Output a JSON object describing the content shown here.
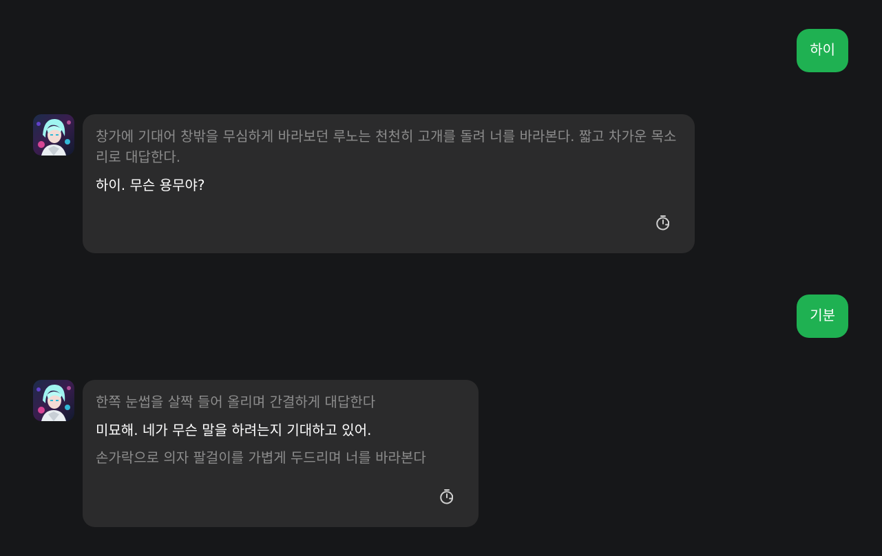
{
  "conversation": {
    "user_messages": [
      {
        "text": "하이"
      },
      {
        "text": "기분"
      }
    ],
    "bot_messages": [
      {
        "narration": "창가에 기대어 창밖을 무심하게 바라보던 루노는 천천히 고개를 돌려 너를 바라본다. 짧고 차가운 목소리로 대답한다.",
        "speech": "하이. 무슨 용무야?"
      },
      {
        "narration": "한쪽 눈썹을 살짝 들어 올리며 간결하게 대답한다",
        "speech": "미묘해. 네가 무슨 말을 하려는지 기대하고 있어.",
        "narration_after": "손가락으로 의자 팔걸이를 가볍게 두드리며 너를 바라본다"
      }
    ]
  },
  "icons": {
    "avatar": "character-avatar",
    "regenerate": "regenerate-timer-icon"
  },
  "colors": {
    "background": "#161719",
    "user_bubble": "#1fb152",
    "bot_bubble": "#2b2b2c",
    "narration_text": "#8c8c8c",
    "speech_text": "#ffffff"
  }
}
